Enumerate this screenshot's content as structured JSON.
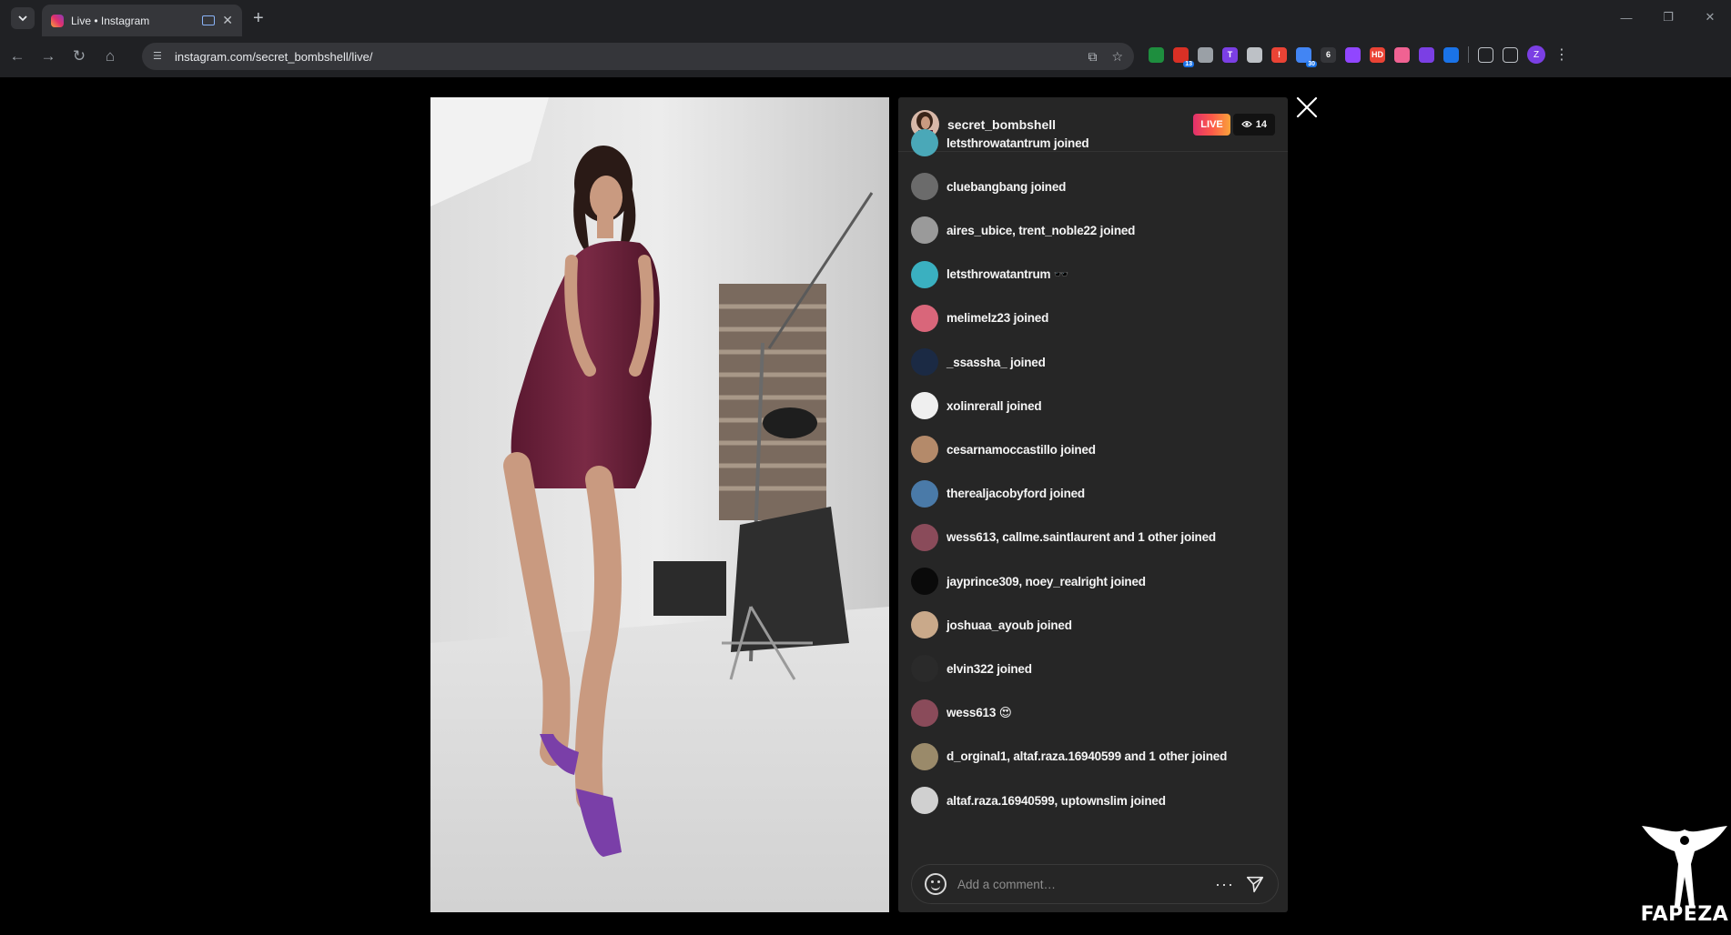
{
  "browser": {
    "tab_title": "Live • Instagram",
    "url": "instagram.com/secret_bombshell/live/",
    "window_controls": [
      "—",
      "❐",
      "✕"
    ],
    "extensions": [
      {
        "name": "ext-globe-icon",
        "color": "#1e8e3e",
        "text": "",
        "badge": ""
      },
      {
        "name": "ext-calendar-icon",
        "color": "#d93025",
        "text": "",
        "badge": "13"
      },
      {
        "name": "ext-mail-icon",
        "color": "#9aa0a6",
        "text": "",
        "badge": ""
      },
      {
        "name": "ext-tampermonkey-icon",
        "color": "#7b3fe4",
        "text": "T",
        "badge": ""
      },
      {
        "name": "ext-translate-icon",
        "color": "#bdc1c6",
        "text": "",
        "badge": ""
      },
      {
        "name": "ext-alert-icon",
        "color": "#ea4335",
        "text": "!",
        "badge": ""
      },
      {
        "name": "ext-network-icon",
        "color": "#4285f4",
        "text": "",
        "badge": "30"
      },
      {
        "name": "ext-count-icon",
        "color": "#35363a",
        "text": "6",
        "badge": ""
      },
      {
        "name": "ext-twitch-icon",
        "color": "#9146ff",
        "text": "",
        "badge": ""
      },
      {
        "name": "ext-hd-icon",
        "color": "#ea4335",
        "text": "HD",
        "badge": ""
      },
      {
        "name": "ext-circle-icon",
        "color": "#f06292",
        "text": "",
        "badge": ""
      },
      {
        "name": "ext-shield-icon",
        "color": "#7b3fe4",
        "text": "",
        "badge": ""
      },
      {
        "name": "ext-tools-icon",
        "color": "#1a73e8",
        "text": "",
        "badge": ""
      }
    ],
    "profile_initial": "Z"
  },
  "live": {
    "username": "secret_bombshell",
    "live_label": "LIVE",
    "viewer_count": "14",
    "comments": [
      {
        "text": "letsthrowatantrum joined",
        "avatar": "#4aa8b8"
      },
      {
        "text": "cluebangbang joined",
        "avatar": "#6b6b6b"
      },
      {
        "text": "aires_ubice, trent_noble22 joined",
        "avatar": "#9a9a9a"
      },
      {
        "text": "letsthrowatantrum 🕶️",
        "avatar": "#3ab0c0"
      },
      {
        "text": "melimelz23 joined",
        "avatar": "#d9667a"
      },
      {
        "text": "_ssassha_ joined",
        "avatar": "#1b2a44"
      },
      {
        "text": "xolinrerall joined",
        "avatar": "#efefef"
      },
      {
        "text": "cesarnamoccastillo joined",
        "avatar": "#b48a6a"
      },
      {
        "text": "therealjacobyford joined",
        "avatar": "#4a7aa8"
      },
      {
        "text": "wess613, callme.saintlaurent and 1 other joined",
        "avatar": "#8a4b5a"
      },
      {
        "text": "jayprince309, noey_realright joined",
        "avatar": "#0a0a0a"
      },
      {
        "text": "joshuaa_ayoub joined",
        "avatar": "#c9a98a"
      },
      {
        "text": "elvin322 joined",
        "avatar": "#2a2a2a"
      },
      {
        "text": "wess613 😍",
        "avatar": "#8a4b5a"
      },
      {
        "text": "d_orginal1, altaf.raza.16940599 and 1 other joined",
        "avatar": "#9a8a6a"
      },
      {
        "text": "altaf.raza.16940599, uptownslim joined",
        "avatar": "#d0d0d0"
      }
    ],
    "comment_placeholder": "Add a comment…"
  },
  "watermark": {
    "text": "FAPEZA"
  }
}
